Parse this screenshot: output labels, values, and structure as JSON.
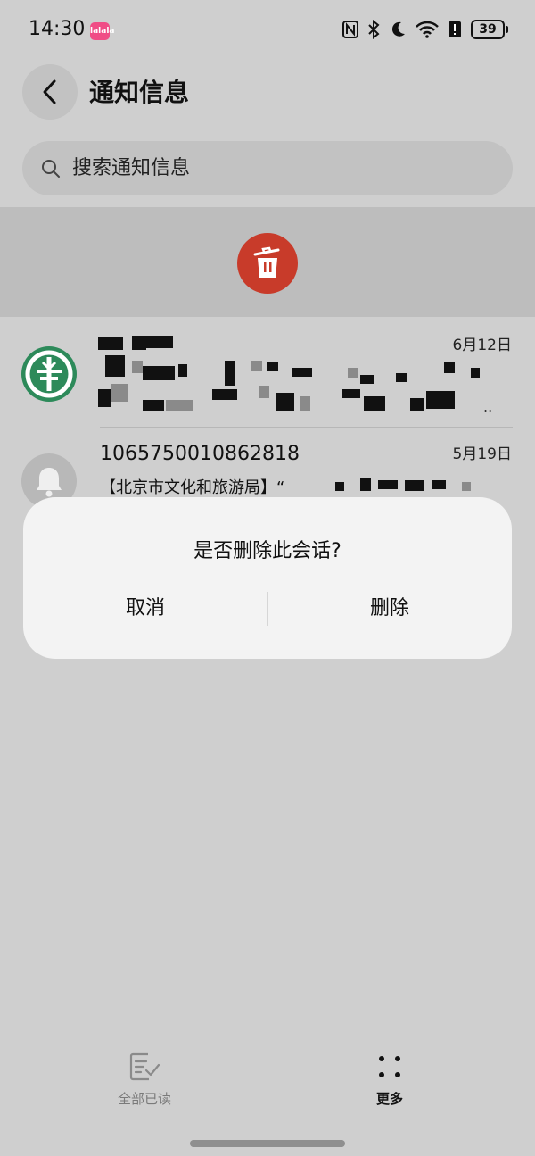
{
  "status_bar": {
    "time": "14:30",
    "app_badge": "lalala",
    "battery": "39",
    "icons": [
      "nfc-icon",
      "bluetooth-icon",
      "do-not-disturb-moon-icon",
      "wifi-icon",
      "alert-icon",
      "battery-icon"
    ]
  },
  "header": {
    "title": "通知信息"
  },
  "search": {
    "placeholder": "搜索通知信息"
  },
  "conversations": [
    {
      "sender": "",
      "preview": "",
      "date": "6月12日",
      "avatar": "bank-logo-icon"
    },
    {
      "sender": "1065750010862818",
      "preview": "【北京市文化和旅游局】“",
      "date": "5月19日",
      "avatar": "bell-icon"
    }
  ],
  "dialog": {
    "title": "是否删除此会话?",
    "cancel_label": "取消",
    "delete_label": "删除"
  },
  "bottom_bar": {
    "read_all_label": "全部已读",
    "more_label": "更多"
  },
  "colors": {
    "background": "#cfcfcf",
    "dialog": "#f3f3f3",
    "trash_button": "#c83b2a",
    "bank_green": "#2d8a5a"
  }
}
